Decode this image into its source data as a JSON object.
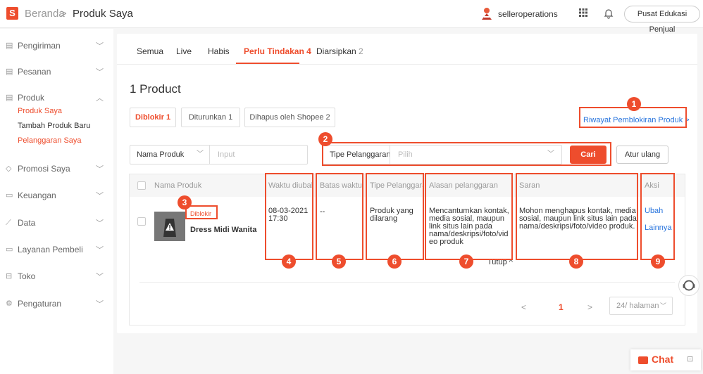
{
  "topbar": {
    "logo_letter": "S",
    "breadcrumb_home": "Beranda",
    "breadcrumb_sep": ">",
    "breadcrumb_current": "Produk Saya",
    "seller_name": "selleroperations",
    "edu_button": "Pusat Edukasi Penjual"
  },
  "sidebar": {
    "sections": [
      {
        "label": "Pengiriman",
        "icon": "truck-icon"
      },
      {
        "label": "Pesanan",
        "icon": "clipboard-icon"
      },
      {
        "label": "Produk",
        "icon": "box-icon"
      },
      {
        "label": "Promosi Saya",
        "icon": "tag-icon"
      },
      {
        "label": "Keuangan",
        "icon": "wallet-icon"
      },
      {
        "label": "Data",
        "icon": "chart-icon"
      },
      {
        "label": "Layanan Pembeli",
        "icon": "chat-icon"
      },
      {
        "label": "Toko",
        "icon": "store-icon"
      },
      {
        "label": "Pengaturan",
        "icon": "gear-icon"
      }
    ],
    "produk_sub": [
      "Produk Saya",
      "Tambah Produk Baru",
      "Pelanggaran Saya"
    ]
  },
  "tabs": {
    "semua": "Semua",
    "live": "Live",
    "habis": "Habis",
    "perlu": "Perlu Tindakan",
    "perlu_count": "4",
    "diarsipkan": "Diarsipkan",
    "diarsipkan_count": "2"
  },
  "product_count": "1 Product",
  "subtabs": {
    "diblokir": "Diblokir 1",
    "diturunkan": "Diturunkan 1",
    "dihapus": "Dihapus oleh Shopee 2"
  },
  "riwayat_link": "Riwayat Pemblokiran Produk >",
  "filter": {
    "nama_label": "Nama Produk",
    "nama_placeholder": "Input",
    "tipe_label": "Tipe Pelanggaran",
    "tipe_placeholder": "Pilih",
    "cari": "Cari",
    "atur_ulang": "Atur ulang"
  },
  "table": {
    "headers": {
      "nama": "Nama Produk",
      "waktu": "Waktu diubah",
      "batas": "Batas waktu",
      "tipe": "Tipe Pelanggaran",
      "alasan": "Alasan pelanggaran",
      "saran": "Saran",
      "aksi": "Aksi"
    },
    "row": {
      "badge": "Diblokir",
      "product_name": "Dress Midi Wanita",
      "waktu_date": "08-03-2021",
      "waktu_time": "17:30",
      "batas": "--",
      "tipe_line1": "Produk yang",
      "tipe_line2": "dilarang",
      "alasan_lines": [
        "Mencantumkan kontak,",
        "media sosial, maupun",
        "link situs lain pada",
        "nama/deskripsi/foto/vid",
        "eo produk"
      ],
      "saran_lines": [
        "Mohon menghapus kontak, media",
        "sosial, maupun link situs lain pada",
        "nama/deskripsi/foto/video produk."
      ],
      "aksi_ubah": "Ubah",
      "aksi_lainnya": "Lainnya"
    },
    "tutup": "Tutup ^"
  },
  "pagination": {
    "prev": "<",
    "current": "1",
    "next": ">",
    "per_page": "24/ halaman"
  },
  "annotations": [
    "1",
    "2",
    "3",
    "4",
    "5",
    "6",
    "7",
    "8",
    "9"
  ],
  "chat_label": "Chat",
  "colors": {
    "accent": "#ee4d2d",
    "link": "#2673dd"
  }
}
